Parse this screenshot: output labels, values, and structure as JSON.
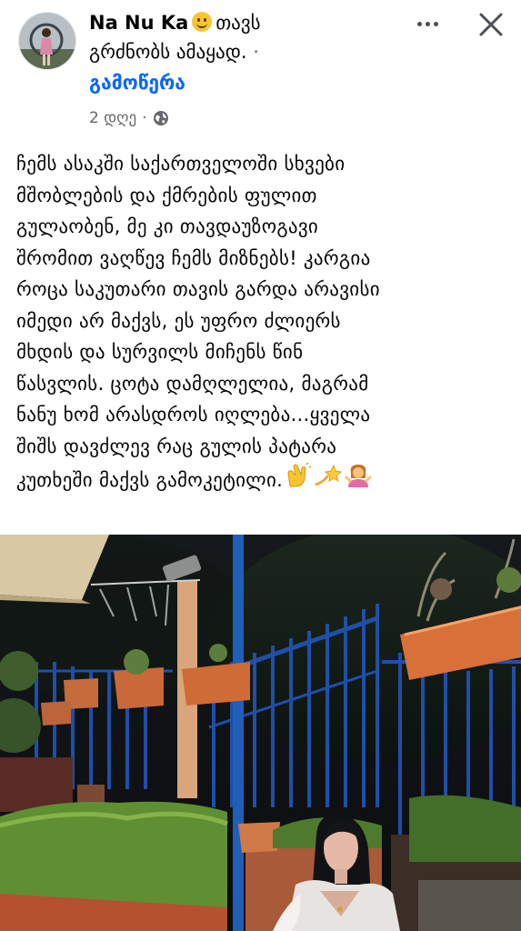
{
  "post": {
    "author": "Na Nu Ka",
    "feeling_text": "თავს",
    "feeling_text_cont": "გრძნობს ამაყად.",
    "separator": "·",
    "follow_label": "გამოწერა",
    "time": "2 დღე",
    "time_separator": "·",
    "privacy_icon": "globe-icon",
    "lines": [
      "ჩემს ასაკში საქართველოში სხვები",
      "მშობლების და ქმრების ფულით",
      "გულაობენ, მე კი თავდაუზოგავი",
      "შრომით ვაღწევ ჩემს მიზნებს! კარგია",
      "როცა საკუთარი თავის გარდა არავისი",
      "იმედი არ მაქვს, ეს უფრო ძლიერს",
      "მხდის და სურვილს მიჩენს წინ",
      "წასვლის. ცოტა დამღლელია, მაგრამ",
      "ნანუ ხომ არასდროს იღლება...ყველა",
      "შიშს დავძლევ რაც გულის პატარა",
      "კუთხეში მაქვს გამოკეტილი."
    ]
  },
  "colors": {
    "link": "#0866ff",
    "meta": "#65676b",
    "text": "#050505"
  }
}
